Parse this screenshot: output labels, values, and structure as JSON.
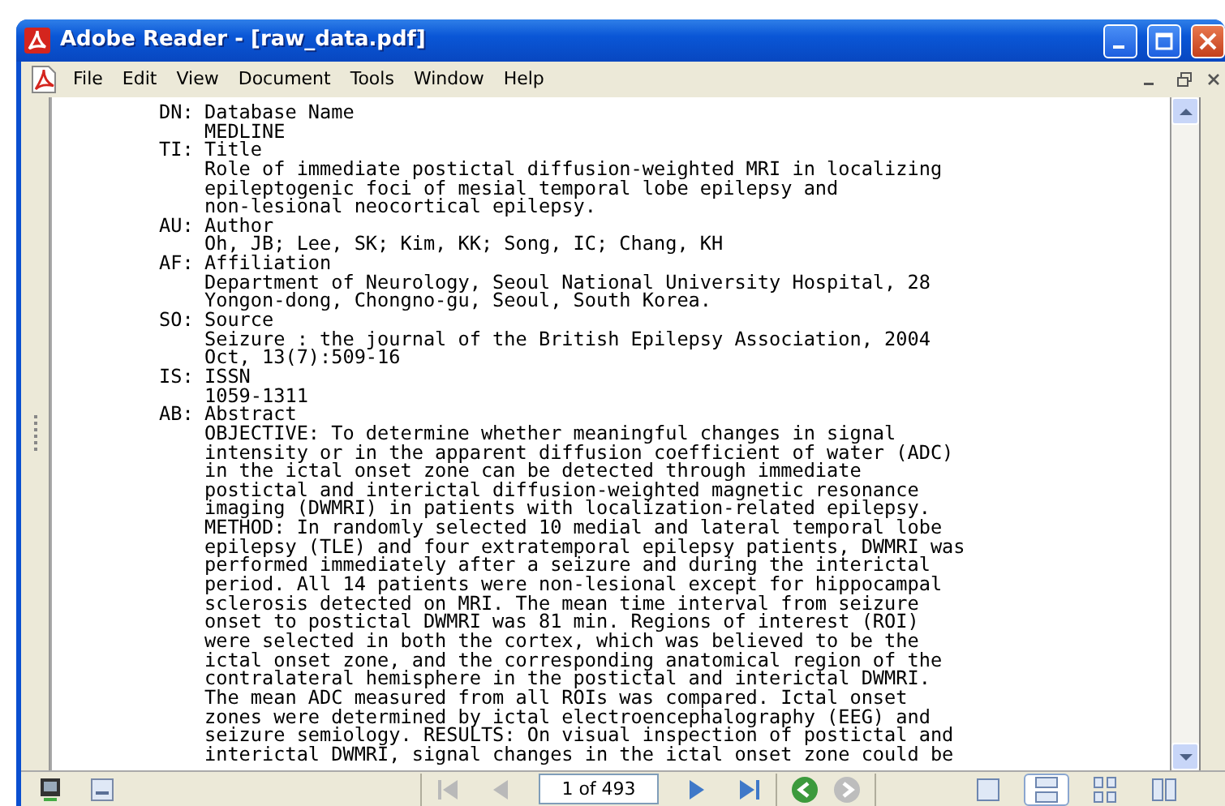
{
  "window": {
    "title": "Adobe Reader - [raw_data.pdf]"
  },
  "menu": [
    "File",
    "Edit",
    "View",
    "Document",
    "Tools",
    "Window",
    "Help"
  ],
  "records": [
    {
      "tag": "DN:",
      "label": "Database Name",
      "lines": [
        "MEDLINE"
      ]
    },
    {
      "tag": "TI:",
      "label": "Title",
      "lines": [
        "Role of immediate postictal diffusion-weighted MRI in localizing",
        "epileptogenic foci of mesial temporal lobe epilepsy and",
        "non-lesional neocortical epilepsy."
      ]
    },
    {
      "tag": "AU:",
      "label": "Author",
      "lines": [
        "Oh, JB; Lee, SK; Kim, KK; Song, IC; Chang, KH"
      ]
    },
    {
      "tag": "AF:",
      "label": "Affiliation",
      "lines": [
        "Department of Neurology, Seoul National University Hospital, 28",
        "Yongon-dong, Chongno-gu, Seoul, South Korea."
      ]
    },
    {
      "tag": "SO:",
      "label": "Source",
      "lines": [
        "Seizure : the journal of the British Epilepsy Association, 2004",
        "Oct, 13(7):509-16"
      ]
    },
    {
      "tag": "IS:",
      "label": "ISSN",
      "lines": [
        "1059-1311"
      ]
    },
    {
      "tag": "AB:",
      "label": "Abstract",
      "lines": [
        "OBJECTIVE: To determine whether meaningful changes in signal",
        "intensity or in the apparent diffusion coefficient of water (ADC)",
        "in the ictal onset zone can be detected through immediate",
        "postictal and interictal diffusion-weighted magnetic resonance",
        "imaging (DWMRI) in patients with localization-related epilepsy.",
        "METHOD: In randomly selected 10 medial and lateral temporal lobe",
        "epilepsy (TLE) and four extratemporal epilepsy patients, DWMRI was",
        "performed immediately after a seizure and during the interictal",
        "period. All 14 patients were non-lesional except for hippocampal",
        "sclerosis detected on MRI. The mean time interval from seizure",
        "onset to postictal DWMRI was 81 min. Regions of interest (ROI)",
        "were selected in both the cortex, which was believed to be the",
        "ictal onset zone, and the corresponding anatomical region of the",
        "contralateral hemisphere in the postictal and interictal DWMRI.",
        "The mean ADC measured from all ROIs was compared. Ictal onset",
        "zones were determined by ictal electroencephalography (EEG) and",
        "seizure semiology. RESULTS: On visual inspection of postictal and",
        "interictal DWMRI, signal changes in the ictal onset zone could be"
      ]
    }
  ],
  "status_bar": {
    "page_field": "1 of 493",
    "nav": [
      {
        "kind": "first",
        "disabled": true
      },
      {
        "kind": "prev",
        "disabled": true
      },
      {
        "kind": "next",
        "disabled": false
      },
      {
        "kind": "last",
        "disabled": false
      }
    ],
    "history": [
      {
        "kind": "back",
        "disabled": false
      },
      {
        "kind": "forward",
        "disabled": true
      }
    ],
    "views": [
      {
        "kind": "single",
        "selected": false
      },
      {
        "kind": "continuous",
        "selected": true
      },
      {
        "kind": "grid",
        "selected": false
      },
      {
        "kind": "facing",
        "selected": false
      }
    ]
  }
}
